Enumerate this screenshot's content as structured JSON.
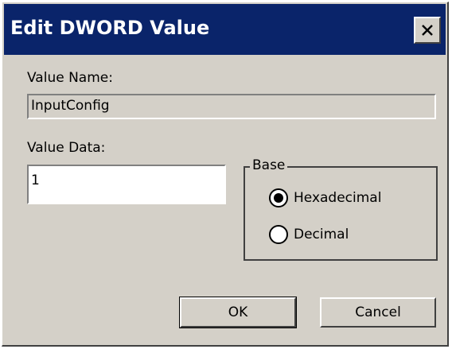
{
  "window": {
    "title": "Edit DWORD Value",
    "close_icon": "close-icon",
    "accent": "#0a246a"
  },
  "value_name": {
    "label": "Value Name:",
    "value": "InputConfig"
  },
  "value_data": {
    "label": "Value Data:",
    "value": "1"
  },
  "base": {
    "label": "Base",
    "options": [
      {
        "label": "Hexadecimal",
        "selected": true
      },
      {
        "label": "Decimal",
        "selected": false
      }
    ]
  },
  "buttons": {
    "ok": "OK",
    "cancel": "Cancel"
  }
}
